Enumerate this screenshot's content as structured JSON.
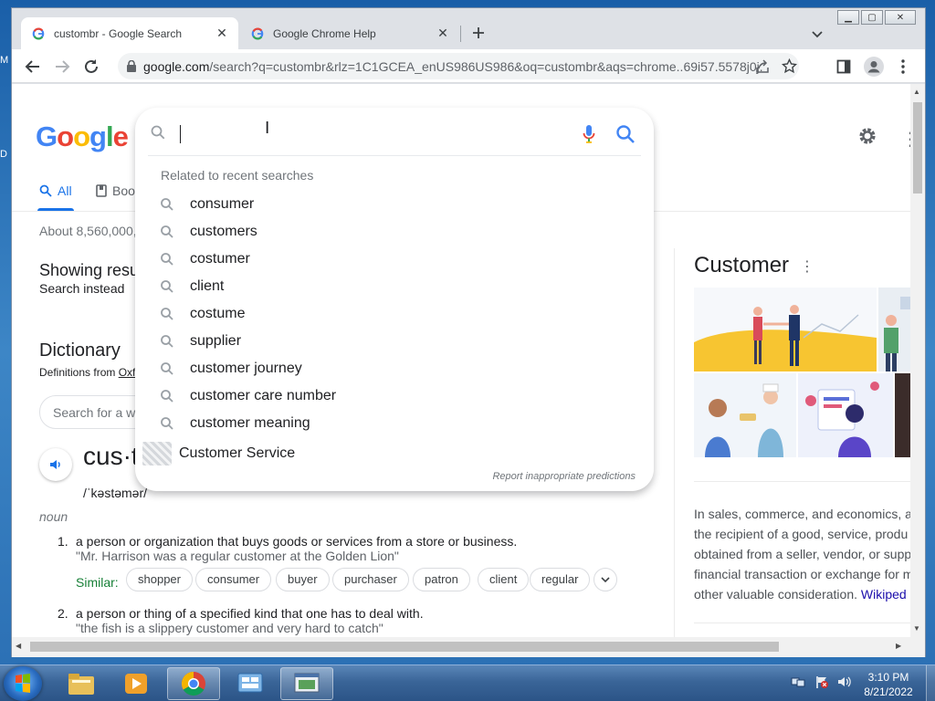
{
  "desktop": {
    "left_glyph_top": "M",
    "left_glyph_mid": "D"
  },
  "browser": {
    "tabs": [
      {
        "title": "custombr - Google Search",
        "active": true
      },
      {
        "title": "Google Chrome Help",
        "active": false
      }
    ],
    "url_host": "google.com",
    "url_rest": "/search?q=custombr&rlz=1C1GCEA_enUS986US986&oq=custombr&aqs=chrome..69i57.5578j0j..."
  },
  "google": {
    "logo": [
      "G",
      "o",
      "o",
      "g",
      "l",
      "e"
    ],
    "logo_colors": [
      "#4285F4",
      "#EA4335",
      "#FBBC05",
      "#4285F4",
      "#34A853",
      "#EA4335"
    ],
    "nav_all": "All",
    "nav_books": "Boo",
    "stats": "About 8,560,000,",
    "showing": "Showing resu",
    "search_instead": "Search instead",
    "dictionary": "Dictionary",
    "defs_from_prefix": "Definitions from ",
    "defs_from_source": "Oxf",
    "dict_search_placeholder": "Search for a w",
    "word": "cus·t",
    "phonetic": "/ˈkəstəmər/",
    "pos": "noun",
    "definitions": [
      {
        "num": "1.",
        "text": "a person or organization that buys goods or services from a store or business.",
        "example": "\"Mr. Harrison was a regular customer at the Golden Lion\""
      },
      {
        "num": "2.",
        "text": "a person or thing of a specified kind that one has to deal with.",
        "example": "\"the fish is a slippery customer and very hard to catch\""
      }
    ],
    "similar_label": "Similar:",
    "similar": [
      "shopper",
      "consumer",
      "buyer",
      "purchaser",
      "patron",
      "client",
      "regular"
    ]
  },
  "autocomplete": {
    "related_label": "Related to recent searches",
    "suggestions": [
      "consumer",
      "customers",
      "costumer",
      "client",
      "costume",
      "supplier",
      "customer journey",
      "customer care number",
      "customer meaning"
    ],
    "entity": "Customer Service",
    "report": "Report inappropriate predictions"
  },
  "knowledge_panel": {
    "title": "Customer",
    "text_lines": [
      "In sales, commerce, and economics, a",
      "the recipient of a good, service, produ",
      "obtained from a seller, vendor, or supp",
      "financial transaction or exchange for m",
      "other valuable consideration. "
    ],
    "link": "Wikiped"
  },
  "taskbar": {
    "time": "3:10 PM",
    "date": "8/21/2022"
  }
}
